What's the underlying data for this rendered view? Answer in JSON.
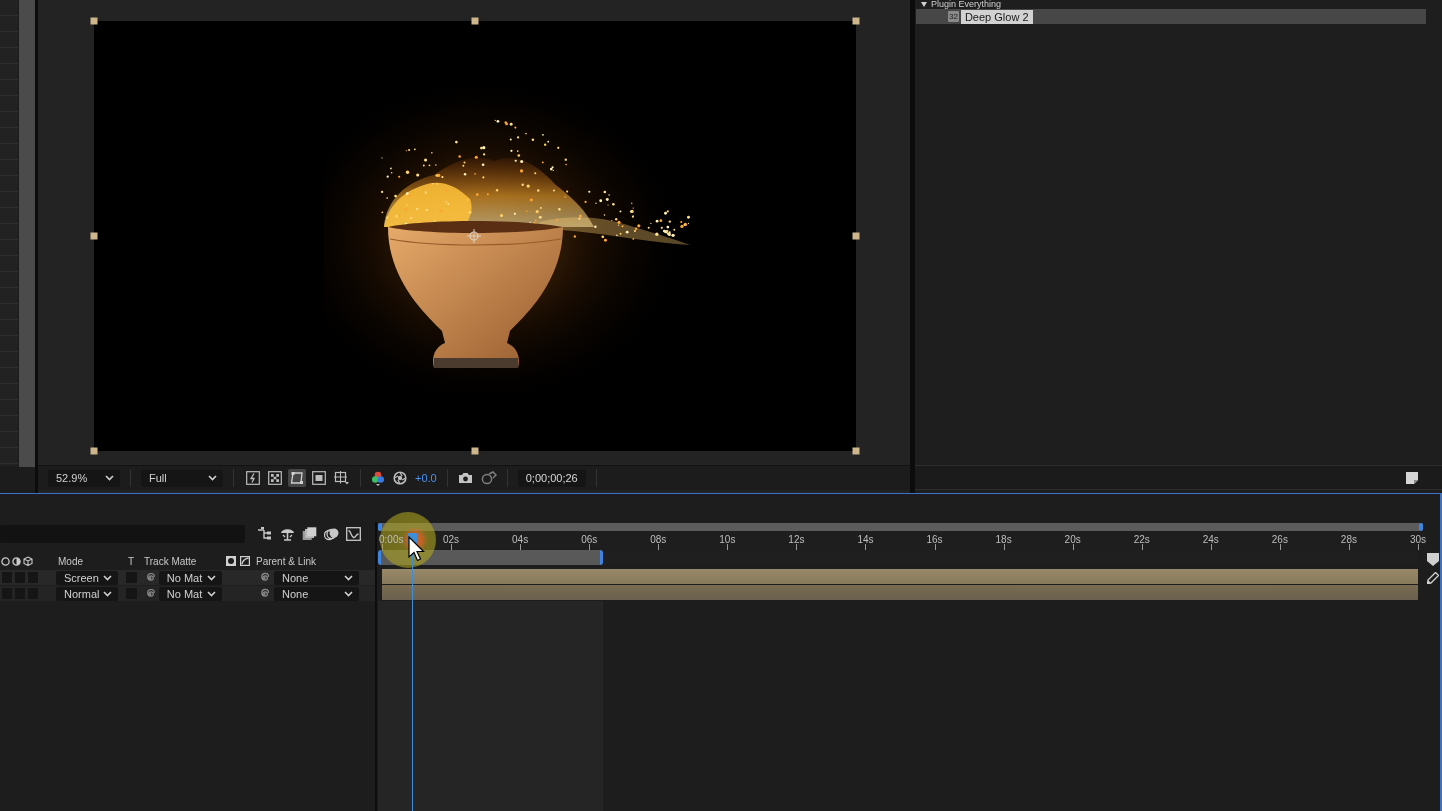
{
  "viewer": {
    "toolbar": {
      "zoom": "52.9%",
      "resolution": "Full",
      "view_toggles": [
        {
          "kind": "previews",
          "selected": false
        },
        {
          "kind": "grid",
          "selected": false
        },
        {
          "kind": "masks",
          "selected": true
        },
        {
          "kind": "region",
          "selected": false
        },
        {
          "kind": "guides",
          "selected": false
        }
      ],
      "exposure": "+0.0",
      "timecode": "0;00;00;26"
    }
  },
  "effects_panel": {
    "tree": [
      {
        "label": "Plugin Everything",
        "expanded": true,
        "children": [
          {
            "label": "Deep Glow 2",
            "badge": "32",
            "selected": true
          }
        ]
      }
    ]
  },
  "timeline": {
    "columns": {
      "mode": "Mode",
      "preserve_transparency": "T",
      "track_matte": "Track Matte",
      "parent": "Parent & Link"
    },
    "layers": [
      {
        "selected": true,
        "switches": [
          {
            "on": false
          },
          {
            "on": false
          },
          {
            "on": false
          }
        ],
        "mode": "Screen",
        "preserve_transparency": false,
        "track_matte": "No Mat",
        "parent": "None"
      },
      {
        "selected": false,
        "switches": [
          {
            "on": false
          },
          {
            "on": false
          },
          {
            "on": false
          }
        ],
        "mode": "Normal",
        "preserve_transparency": false,
        "track_matte": "No Mat",
        "parent": "None"
      }
    ],
    "ruler": {
      "labels": [
        "0:00s",
        "02s",
        "04s",
        "06s",
        "08s",
        "10s",
        "12s",
        "14s",
        "16s",
        "18s",
        "20s",
        "22s",
        "24s",
        "26s",
        "28s",
        "30s"
      ]
    },
    "playhead": {
      "level": 0.029
    },
    "work_area": {
      "level": 0.217
    }
  }
}
